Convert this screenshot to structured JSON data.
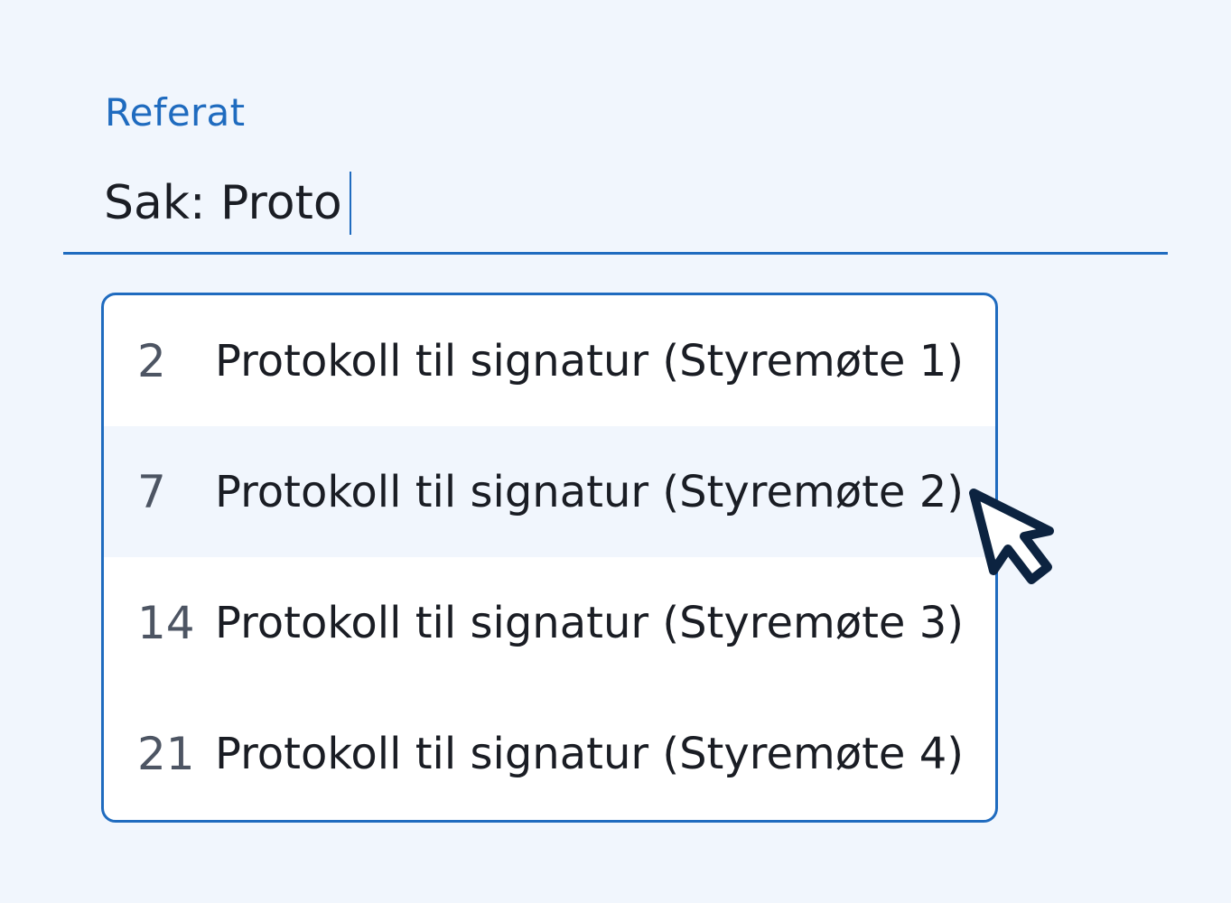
{
  "field": {
    "label": "Referat",
    "value": "Sak: Proto"
  },
  "dropdown": {
    "options": [
      {
        "number": "2",
        "title": "Protokoll til signatur (Styremøte 1)"
      },
      {
        "number": "7",
        "title": "Protokoll til signatur (Styremøte 2)"
      },
      {
        "number": "14",
        "title": "Protokoll til signatur (Styremøte 3)"
      },
      {
        "number": "21",
        "title": "Protokoll til signatur (Styremøte 4)"
      }
    ]
  },
  "colors": {
    "background": "#f1f6fd",
    "accent": "#1f6bbf",
    "text": "#1a1d24",
    "muted_text": "#4d5563",
    "hover_row": "#f1f6fd",
    "cursor_outline": "#0c2340"
  },
  "icons": {
    "cursor": "mouse-pointer-icon"
  }
}
